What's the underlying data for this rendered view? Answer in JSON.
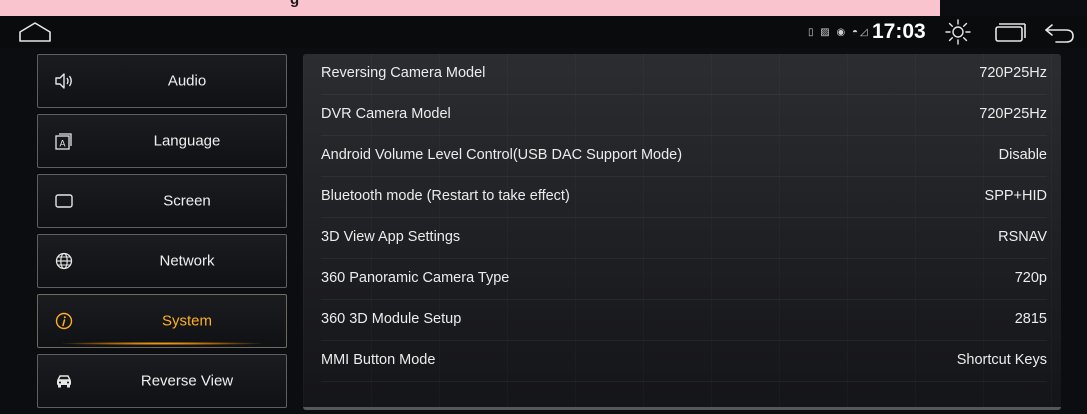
{
  "banner": {
    "text": "g"
  },
  "status": {
    "icons_text": "▯ ▨ ◉ ◓◿",
    "time": "17:03"
  },
  "sidebar": {
    "items": [
      {
        "label": "Audio",
        "icon": "speaker-icon"
      },
      {
        "label": "Language",
        "icon": "language-icon"
      },
      {
        "label": "Screen",
        "icon": "screen-icon"
      },
      {
        "label": "Network",
        "icon": "globe-icon"
      },
      {
        "label": "System",
        "icon": "info-icon",
        "active": true
      },
      {
        "label": "Reverse View",
        "icon": "car-icon"
      }
    ]
  },
  "settings": {
    "rows": [
      {
        "label": "Reversing Camera Model",
        "value": "720P25Hz"
      },
      {
        "label": "DVR Camera Model",
        "value": "720P25Hz"
      },
      {
        "label": "Android Volume Level Control(USB DAC Support Mode)",
        "value": "Disable"
      },
      {
        "label": "Bluetooth mode (Restart to take effect)",
        "value": "SPP+HID"
      },
      {
        "label": "3D View App Settings",
        "value": "RSNAV"
      },
      {
        "label": "360 Panoramic Camera Type",
        "value": "720p"
      },
      {
        "label": "360 3D Module Setup",
        "value": "2815"
      },
      {
        "label": "MMI Button Mode",
        "value": "Shortcut Keys"
      }
    ]
  },
  "colors": {
    "accent": "#ffb020",
    "background": "#0c0d10",
    "panel": "#25262a",
    "banner": "#f9c4cd"
  }
}
